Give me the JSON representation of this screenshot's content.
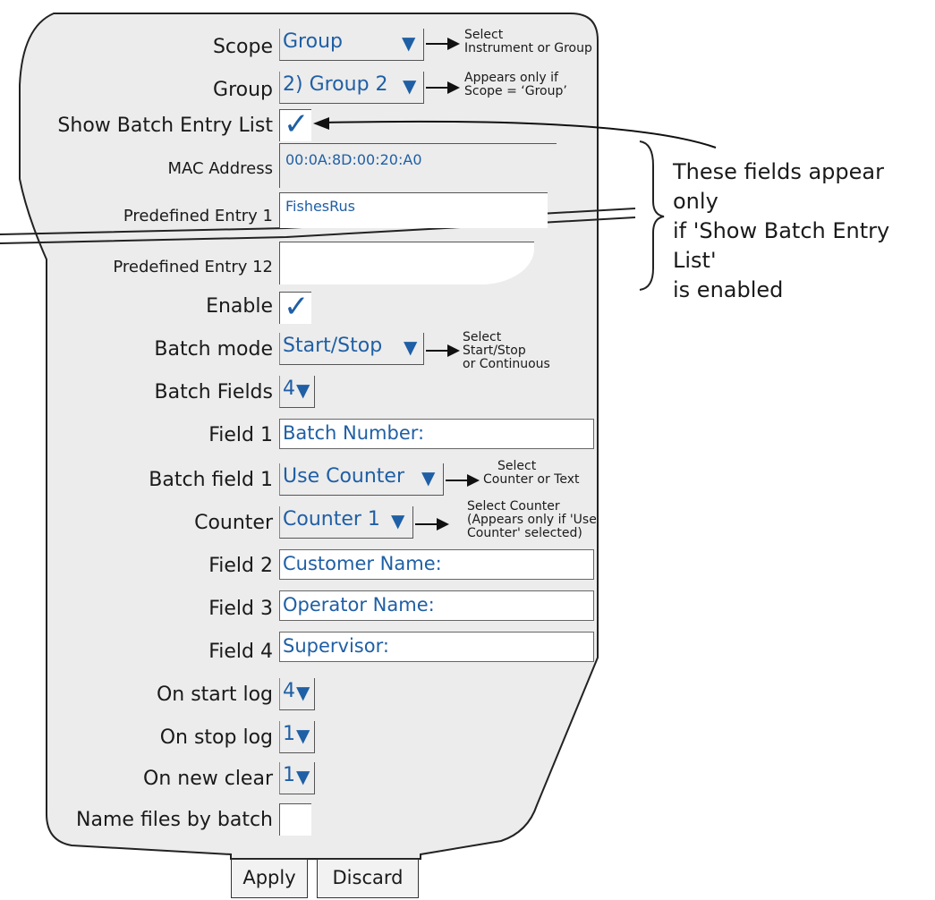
{
  "rows": {
    "scope": {
      "label": "Scope",
      "value": "Group",
      "note": [
        "Select",
        "Instrument or Group"
      ]
    },
    "group": {
      "label": "Group",
      "value": "2) Group 2",
      "note": [
        "Appears only if",
        "Scope = ‘Group’"
      ]
    },
    "show_batch_entry_list": {
      "label": "Show Batch Entry List",
      "checked": true
    },
    "mac_address": {
      "label": "MAC Address",
      "value": "00:0A:8D:00:20:A0"
    },
    "predefined_entry_1": {
      "label": "Predefined Entry 1",
      "value": "FishesRus"
    },
    "predefined_entry_12": {
      "label": "Predefined Entry 12",
      "value": ""
    },
    "enable": {
      "label": "Enable",
      "checked": true
    },
    "batch_mode": {
      "label": "Batch mode",
      "value": "Start/Stop",
      "note": [
        "Select",
        "Start/Stop",
        "or Continuous"
      ]
    },
    "batch_fields": {
      "label": "Batch Fields",
      "value": "4"
    },
    "field_1": {
      "label": "Field 1",
      "value": "Batch Number:"
    },
    "batch_field_1": {
      "label": "Batch field 1",
      "value": "Use Counter",
      "note": [
        "Select",
        "Counter or Text"
      ]
    },
    "counter": {
      "label": "Counter",
      "value": "Counter 1",
      "note": [
        "Select Counter",
        "(Appears only if 'Use",
        "Counter' selected)"
      ]
    },
    "field_2": {
      "label": "Field 2",
      "value": "Customer Name:"
    },
    "field_3": {
      "label": "Field 3",
      "value": "Operator Name:"
    },
    "field_4": {
      "label": "Field 4",
      "value": "Supervisor:"
    },
    "on_start_log": {
      "label": "On start log",
      "value": "4"
    },
    "on_stop_log": {
      "label": "On stop log",
      "value": "1"
    },
    "on_new_clear": {
      "label": "On new clear",
      "value": "1"
    },
    "name_files_by_batch": {
      "label": "Name files by batch",
      "checked": false
    }
  },
  "side_note": [
    "These fields appear only",
    "if 'Show Batch Entry List'",
    "is enabled"
  ],
  "buttons": {
    "apply": "Apply",
    "discard": "Discard"
  },
  "icons": {
    "dropdown": "triangle-down-icon",
    "check": "checkmark-icon"
  },
  "colors": {
    "value_text": "#1f5fa5",
    "panel": "#ececec"
  }
}
